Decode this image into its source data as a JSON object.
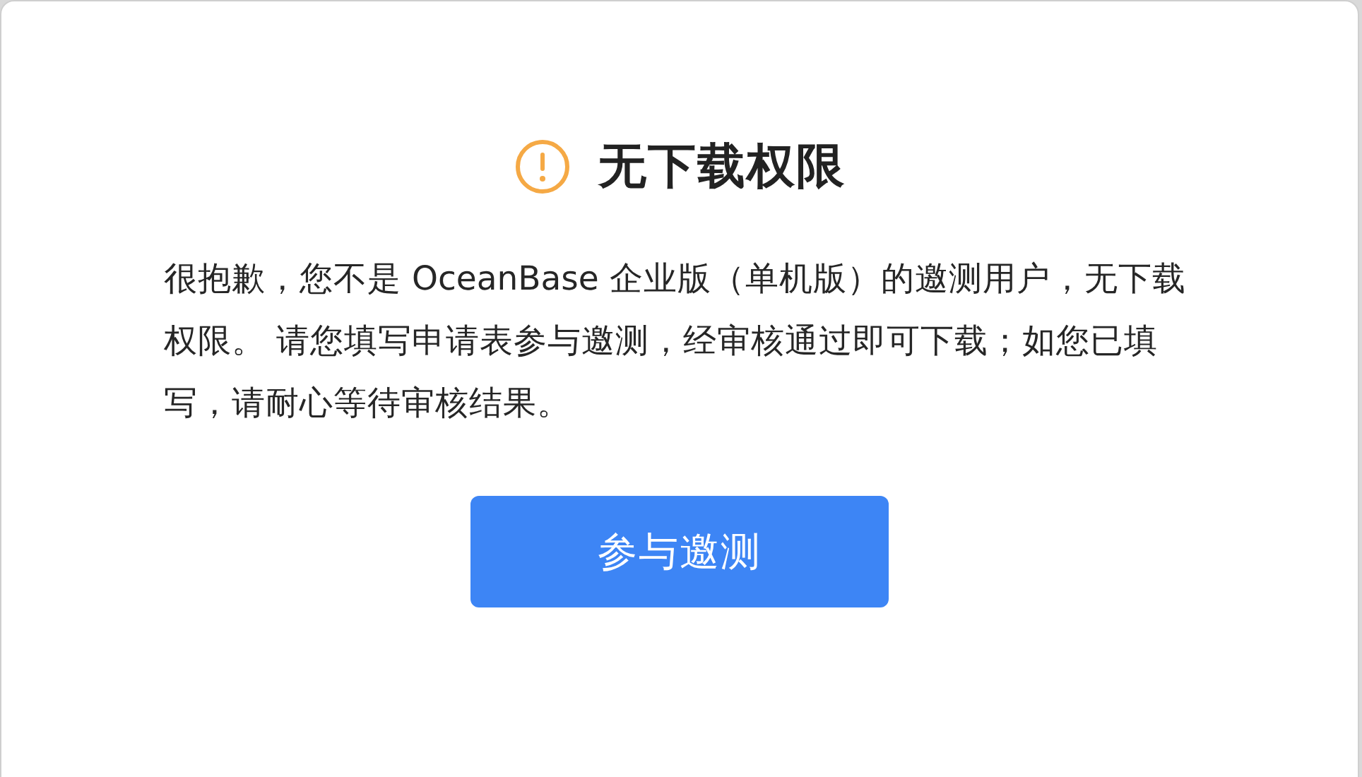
{
  "dialog": {
    "title": "无下载权限",
    "message": "很抱歉，您不是 OceanBase 企业版（单机版）的邀测用户，无下载权限。 请您填写申请表参与邀测，经审核通过即可下载；如您已填写，请耐心等待审核结果。",
    "button": "参与邀测"
  }
}
